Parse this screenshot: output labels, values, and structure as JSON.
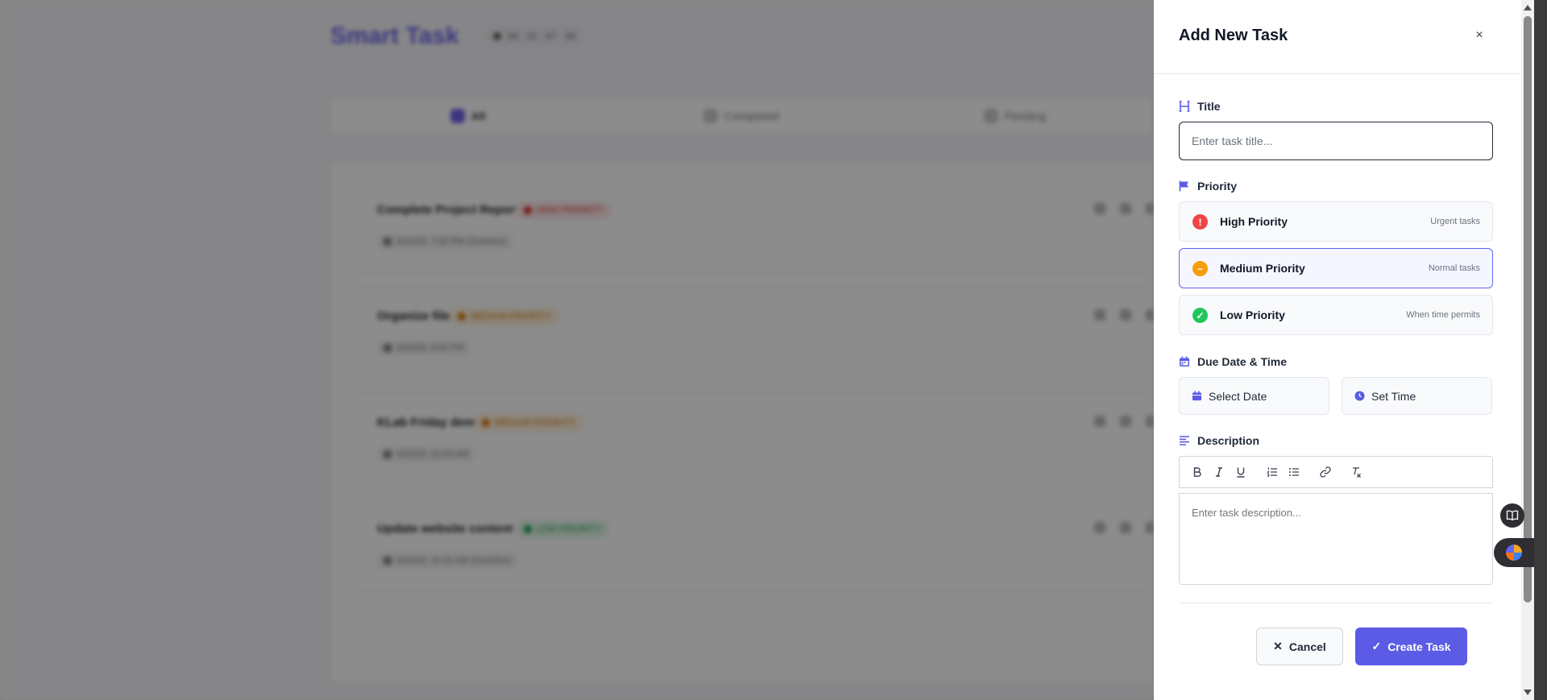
{
  "background": {
    "brand": "Smart Task",
    "clock": "04 : 21 : 47 · 34",
    "tabs": [
      {
        "label": "All",
        "active": true
      },
      {
        "label": "Completed",
        "active": false
      },
      {
        "label": "Pending",
        "active": false
      }
    ],
    "tasks": [
      {
        "title": "Complete Project Report",
        "badge": "HIGH PRIORITY",
        "badge_color": "#dc2626",
        "badge_bg": "#fde8e8",
        "date": "4/14/25, 7:30 PM (Overdue)"
      },
      {
        "title": "Organize files",
        "badge": "MEDIUM PRIORITY",
        "badge_color": "#d97706",
        "badge_bg": "#fdf1dc",
        "date": "4/25/25, 8:00 PM"
      },
      {
        "title": "KLab Friday demo",
        "badge": "MEDIUM PRIORITY",
        "badge_color": "#d97706",
        "badge_bg": "#fdf1dc",
        "date": "4/25/25, 10:00 AM"
      },
      {
        "title": "Update website content",
        "badge": "LOW PRIORITY",
        "badge_color": "#16a34a",
        "badge_bg": "#e2f6e8",
        "date": "4/23/25, 10:31 AM (Overdue)"
      }
    ]
  },
  "drawer": {
    "title": "Add New Task",
    "close_icon": "×",
    "title_field": {
      "label": "Title",
      "placeholder": "Enter task title...",
      "value": ""
    },
    "priority": {
      "label": "Priority",
      "options": [
        {
          "name": "High Priority",
          "hint": "Urgent tasks",
          "icon": "!",
          "color": "#ef4444",
          "selected": false
        },
        {
          "name": "Medium Priority",
          "hint": "Normal tasks",
          "icon": "−",
          "color": "#f59e0b",
          "selected": true
        },
        {
          "name": "Low Priority",
          "hint": "When time permits",
          "icon": "✓",
          "color": "#22c55e",
          "selected": false
        }
      ]
    },
    "due": {
      "label": "Due Date & Time",
      "date_button": "Select Date",
      "time_button": "Set Time"
    },
    "description": {
      "label": "Description",
      "placeholder": "Enter task description..."
    },
    "cancel_label": "Cancel",
    "create_label": "Create Task",
    "accent": "#5b5be6"
  }
}
